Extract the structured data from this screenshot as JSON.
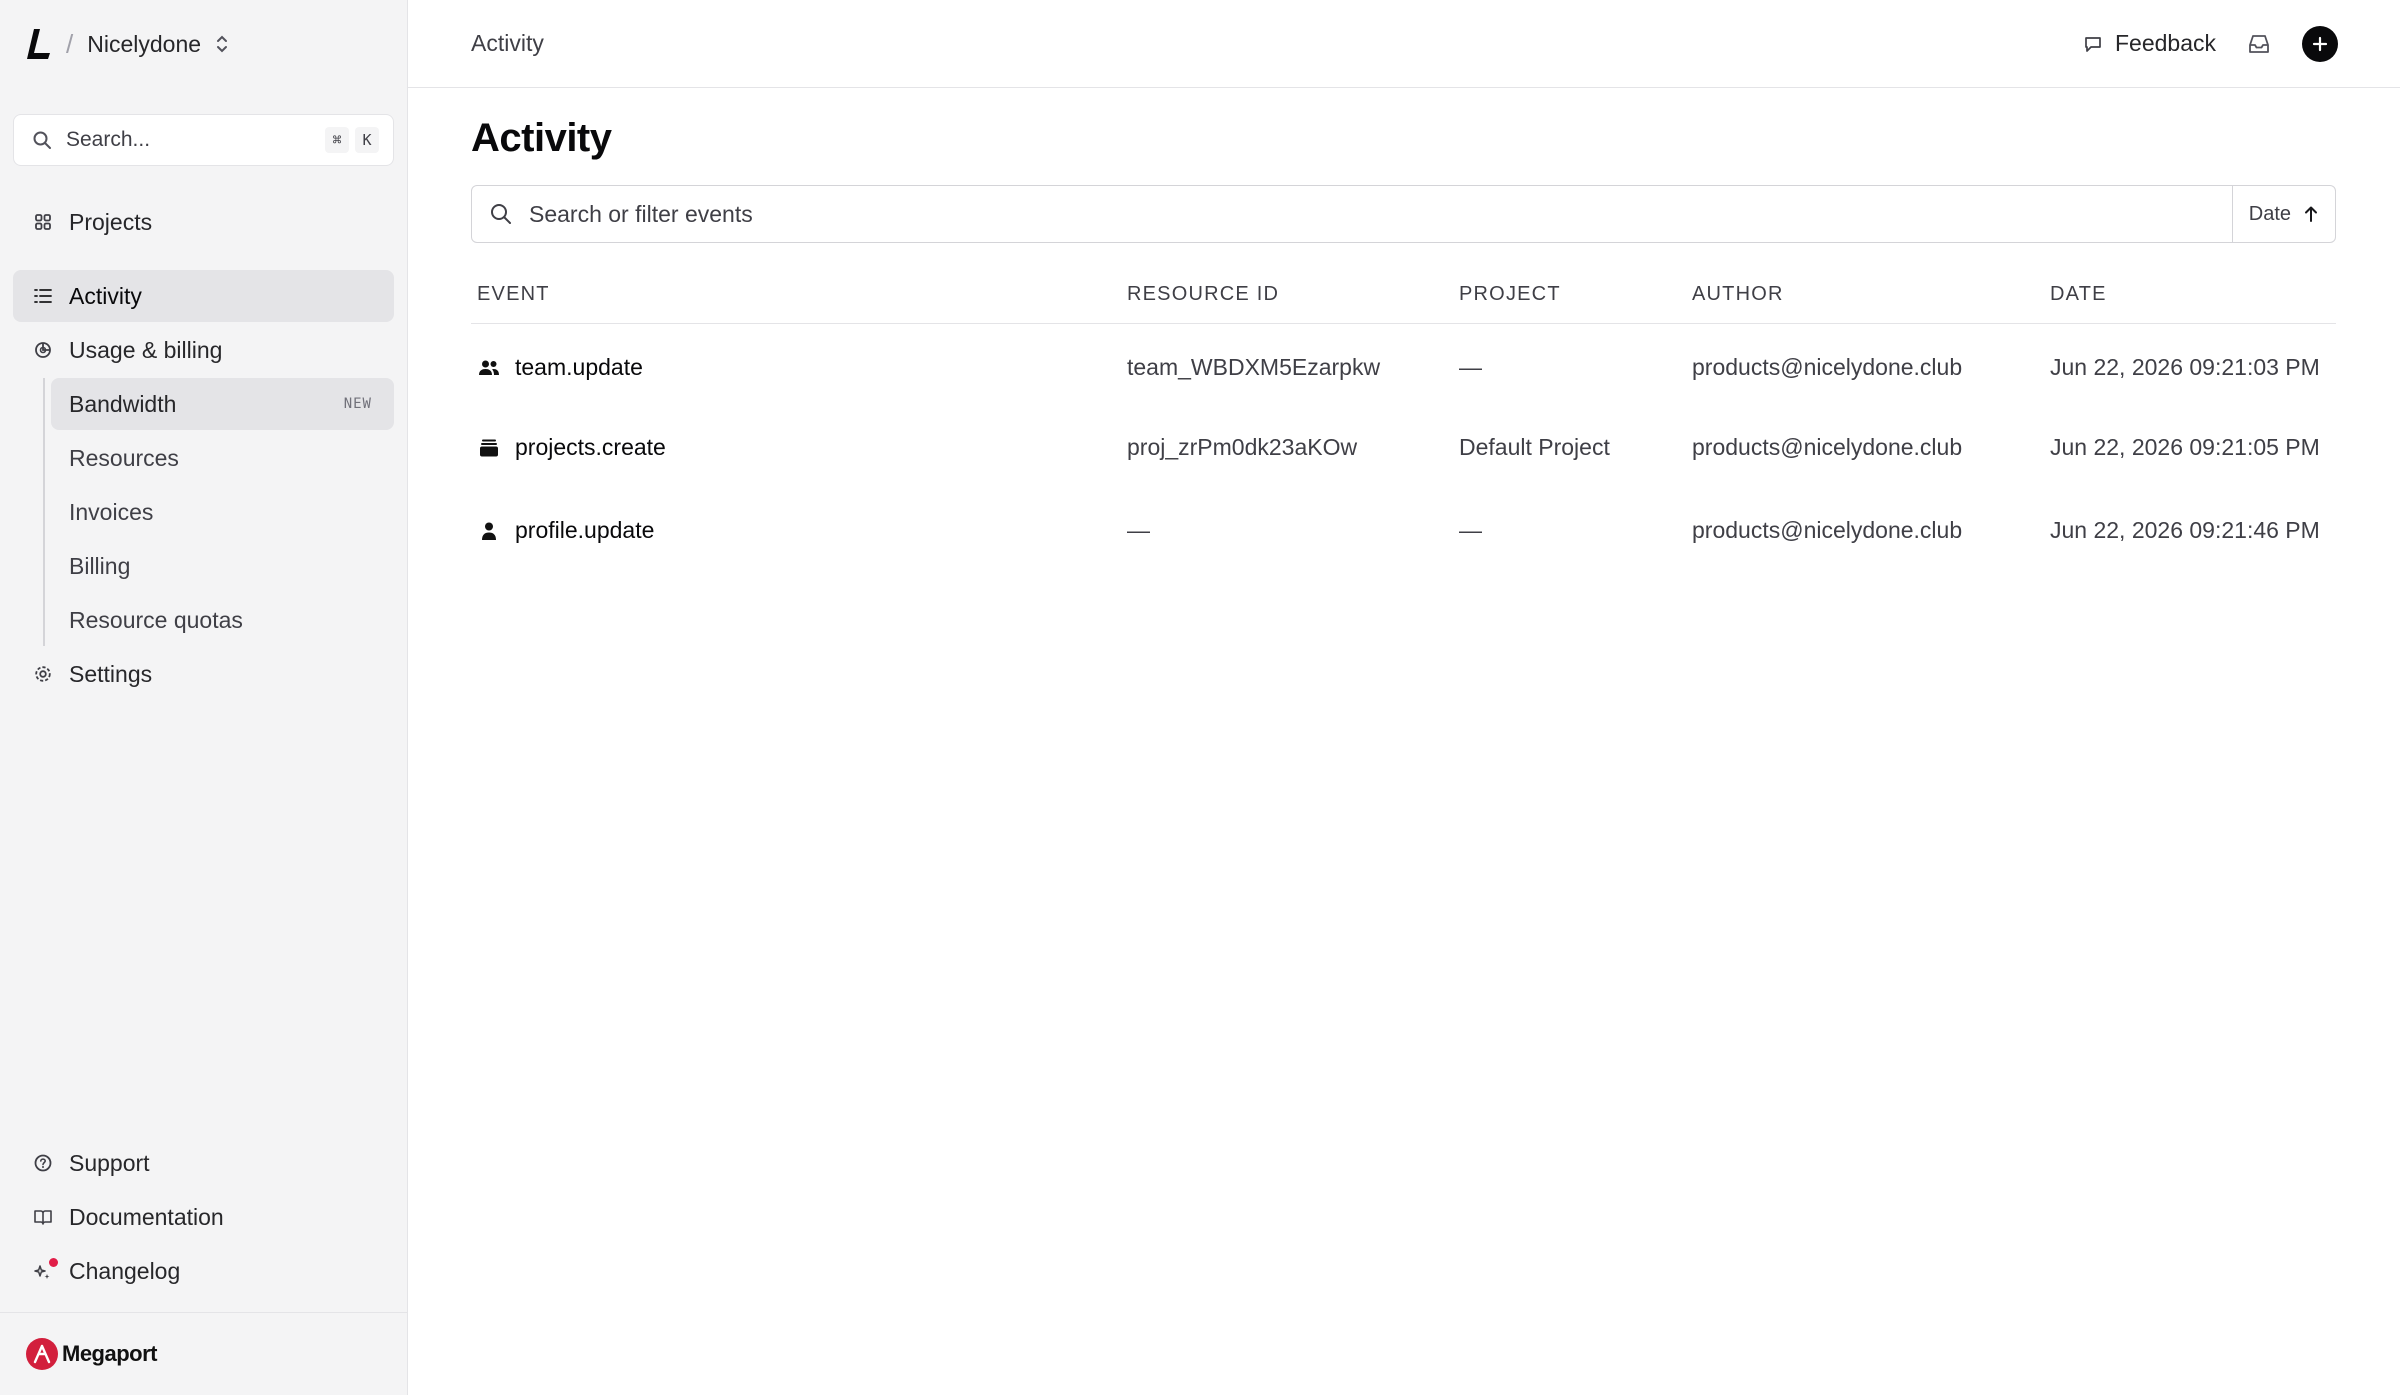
{
  "sidebar": {
    "workspace": {
      "slash": "/",
      "name": "Nicelydone"
    },
    "search": {
      "placeholder": "Search...",
      "shortcut_mod": "⌘",
      "shortcut_key": "K"
    },
    "nav": {
      "projects": "Projects",
      "activity": "Activity",
      "usage": "Usage & billing",
      "settings": "Settings"
    },
    "usage_sub": [
      {
        "label": "Bandwidth",
        "badge": "NEW"
      },
      {
        "label": "Resources"
      },
      {
        "label": "Invoices"
      },
      {
        "label": "Billing"
      },
      {
        "label": "Resource quotas"
      }
    ],
    "bottom": {
      "support": "Support",
      "documentation": "Documentation",
      "changelog": "Changelog"
    },
    "brand": {
      "name": "Megaport",
      "color": "#d21f3c"
    }
  },
  "topbar": {
    "breadcrumb": "Activity",
    "feedback": "Feedback"
  },
  "main": {
    "title": "Activity",
    "filter_placeholder": "Search or filter events",
    "sort_label": "Date",
    "columns": [
      "EVENT",
      "RESOURCE ID",
      "PROJECT",
      "AUTHOR",
      "DATE"
    ],
    "rows": [
      {
        "icon": "users-icon",
        "event": "team.update",
        "resource_id": "team_WBDXM5Ezarpkw",
        "project": "—",
        "author": "products@nicelydone.club",
        "date": "Jun 22, 2026 09:21:03 PM"
      },
      {
        "icon": "stack-icon",
        "event": "projects.create",
        "resource_id": "proj_zrPm0dk23aKOw",
        "project": "Default Project",
        "author": "products@nicelydone.club",
        "date": "Jun 22, 2026 09:21:05 PM"
      },
      {
        "icon": "user-icon",
        "event": "profile.update",
        "resource_id": "—",
        "project": "—",
        "author": "products@nicelydone.club",
        "date": "Jun 22, 2026 09:21:46 PM"
      }
    ]
  }
}
